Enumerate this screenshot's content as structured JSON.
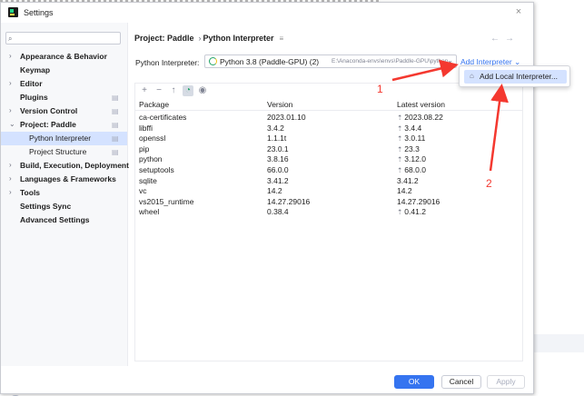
{
  "window": {
    "title": "Settings",
    "close_glyph": "×"
  },
  "sidebar": {
    "search": {
      "value": "",
      "placeholder": ""
    },
    "items": [
      {
        "label": "Appearance & Behavior",
        "chevron": "›",
        "bold": true
      },
      {
        "label": "Keymap",
        "bold": true
      },
      {
        "label": "Editor",
        "chevron": "›",
        "bold": true
      },
      {
        "label": "Plugins",
        "bold": true,
        "gear": true
      },
      {
        "label": "Version Control",
        "chevron": "›",
        "bold": true,
        "gear": true
      },
      {
        "label": "Project: Paddle",
        "chevron": "⌄",
        "bold": true,
        "gear": true
      },
      {
        "label": "Python Interpreter",
        "child": true,
        "selected": true,
        "gear": true
      },
      {
        "label": "Project Structure",
        "child": true,
        "gear": true
      },
      {
        "label": "Build, Execution, Deployment",
        "chevron": "›",
        "bold": true
      },
      {
        "label": "Languages & Frameworks",
        "chevron": "›",
        "bold": true
      },
      {
        "label": "Tools",
        "chevron": "›",
        "bold": true
      },
      {
        "label": "Settings Sync",
        "bold": true
      },
      {
        "label": "Advanced Settings",
        "bold": true
      }
    ],
    "help_glyph": "?"
  },
  "main": {
    "breadcrumb": {
      "parent": "Project: Paddle",
      "separator": "›",
      "current": "Python Interpreter"
    },
    "interpreter": {
      "label": "Python Interpreter:",
      "name": "Python 3.8 (Paddle-GPU) (2)",
      "path": "E:\\Anaconda-envs\\envs\\Paddle-GPU\\python.e",
      "add_label": "Add Interpreter"
    },
    "popup": {
      "item_label": "Add Local Interpreter..."
    },
    "packages": {
      "columns": [
        "Package",
        "Version",
        "Latest version"
      ],
      "rows": [
        {
          "package": "ca-certificates",
          "version": "2023.01.10",
          "latest": "2023.08.22",
          "upgrade": true
        },
        {
          "package": "libffi",
          "version": "3.4.2",
          "latest": "3.4.4",
          "upgrade": true
        },
        {
          "package": "openssl",
          "version": "1.1.1t",
          "latest": "3.0.11",
          "upgrade": true
        },
        {
          "package": "pip",
          "version": "23.0.1",
          "latest": "23.3",
          "upgrade": true
        },
        {
          "package": "python",
          "version": "3.8.16",
          "latest": "3.12.0",
          "upgrade": true
        },
        {
          "package": "setuptools",
          "version": "66.0.0",
          "latest": "68.0.0",
          "upgrade": true
        },
        {
          "package": "sqlite",
          "version": "3.41.2",
          "latest": "3.41.2",
          "upgrade": false
        },
        {
          "package": "vc",
          "version": "14.2",
          "latest": "14.2",
          "upgrade": false
        },
        {
          "package": "vs2015_runtime",
          "version": "14.27.29016",
          "latest": "14.27.29016",
          "upgrade": false
        },
        {
          "package": "wheel",
          "version": "0.38.4",
          "latest": "0.41.2",
          "upgrade": true
        }
      ]
    }
  },
  "footer": {
    "ok": "OK",
    "cancel": "Cancel",
    "apply": "Apply"
  },
  "annotations": {
    "marker_1": "1",
    "marker_2": "2",
    "color": "#f4382f"
  },
  "colors": {
    "accent": "#3574f0",
    "selection": "#d4e2ff"
  }
}
